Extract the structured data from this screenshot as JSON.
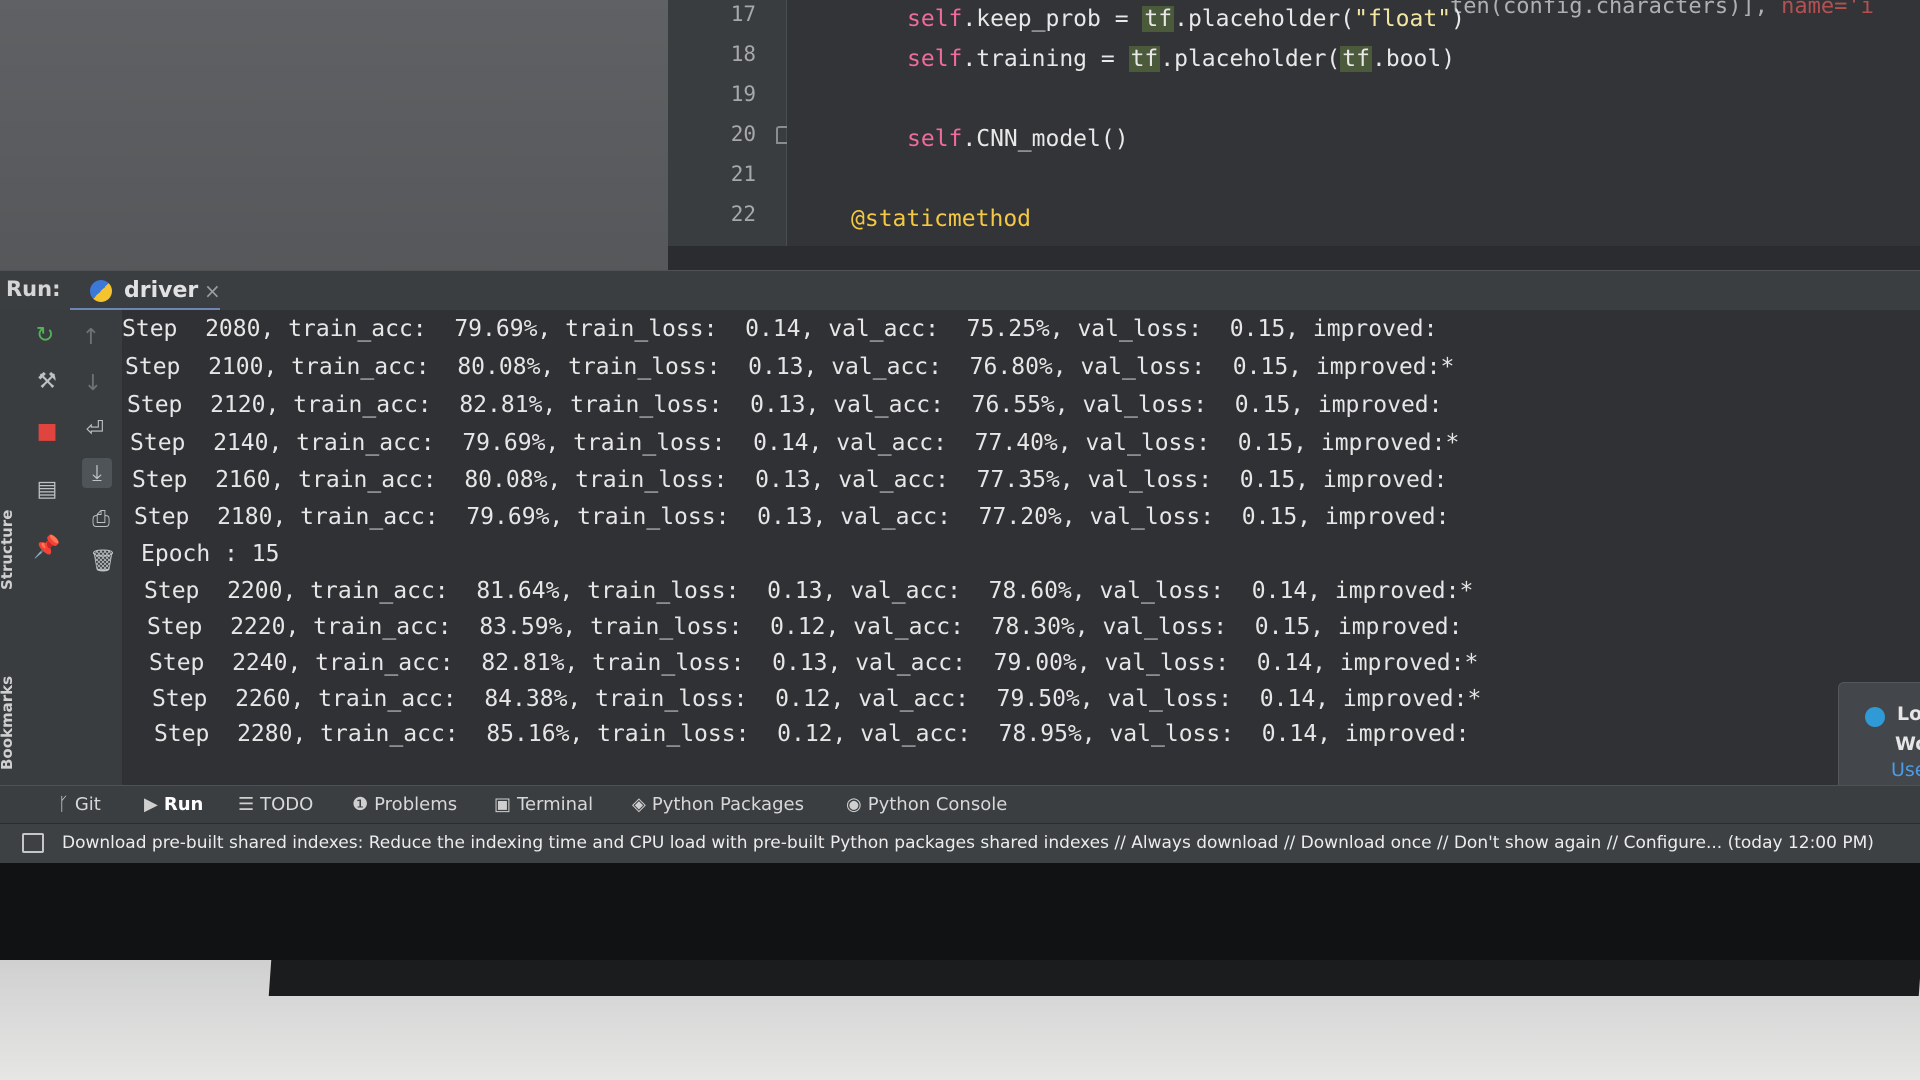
{
  "editor": {
    "line_numbers": [
      "17",
      "18",
      "19",
      "20",
      "21",
      "22"
    ],
    "lines": {
      "l17": {
        "self": "self",
        "mid": ".keep_prob = ",
        "tf": "tf",
        "rest": ".placeholder(",
        "str": "\"float\"",
        "end": ")"
      },
      "l18": {
        "self": "self",
        "mid": ".training = ",
        "tf": "tf",
        "rest": ".placeholder(",
        "tf2": "tf",
        "end": ".bool)"
      },
      "l20": {
        "self": "self",
        "rest": ".CNN_model()"
      },
      "l22": {
        "deco": "@staticmethod"
      }
    },
    "top_right_fragment": {
      "text": "ten(config.characters)], ",
      "red": "name='i"
    }
  },
  "run_window": {
    "label": "Run:",
    "tab_label": "driver",
    "close_glyph": "×",
    "console_lines": [
      "Step  2080, train_acc:  79.69%, train_loss:  0.14, val_acc:  75.25%, val_loss:  0.15, improved:",
      "Step  2100, train_acc:  80.08%, train_loss:  0.13, val_acc:  76.80%, val_loss:  0.15, improved:*",
      "Step  2120, train_acc:  82.81%, train_loss:  0.13, val_acc:  76.55%, val_loss:  0.15, improved:",
      "Step  2140, train_acc:  79.69%, train_loss:  0.14, val_acc:  77.40%, val_loss:  0.15, improved:*",
      "Step  2160, train_acc:  80.08%, train_loss:  0.13, val_acc:  77.35%, val_loss:  0.15, improved:",
      "Step  2180, train_acc:  79.69%, train_loss:  0.13, val_acc:  77.20%, val_loss:  0.15, improved:",
      "Epoch : 15",
      "Step  2200, train_acc:  81.64%, train_loss:  0.13, val_acc:  78.60%, val_loss:  0.14, improved:*",
      "Step  2220, train_acc:  83.59%, train_loss:  0.12, val_acc:  78.30%, val_loss:  0.15, improved:",
      "Step  2240, train_acc:  82.81%, train_loss:  0.13, val_acc:  79.00%, val_loss:  0.14, improved:*",
      "Step  2260, train_acc:  84.38%, train_loss:  0.12, val_acc:  79.50%, val_loss:  0.14, improved:*",
      "Step  2280, train_acc:  85.16%, train_loss:  0.12, val_acc:  78.95%, val_loss:  0.14, improved:"
    ]
  },
  "side_strip": {
    "structure": "Structure",
    "bookmarks": "Bookmarks"
  },
  "popup": {
    "line1": "Lo",
    "line2": "Wo",
    "link": "Use"
  },
  "bottom_tabs": [
    {
      "icon": "git-icon",
      "glyph": "ᚴ",
      "label": "Git"
    },
    {
      "icon": "run-icon",
      "glyph": "▶",
      "label": "Run"
    },
    {
      "icon": "todo-icon",
      "glyph": "☰",
      "label": "TODO"
    },
    {
      "icon": "problems-icon",
      "glyph": "❶",
      "label": "Problems"
    },
    {
      "icon": "terminal-icon",
      "glyph": "▣",
      "label": "Terminal"
    },
    {
      "icon": "python-packages-icon",
      "glyph": "◈",
      "label": "Python Packages"
    },
    {
      "icon": "python-console-icon",
      "glyph": "◉",
      "label": "Python Console"
    }
  ],
  "status_bar": {
    "message": "Download pre-built shared indexes: Reduce the indexing time and CPU load with pre-built Python packages shared indexes // Always download // Download once // Don't show again // Configure... (today 12:00 PM)"
  },
  "colors": {
    "accent_tab_underline": "#6d86b3",
    "self_keyword": "#f06a9a",
    "decorator": "#f5c842",
    "stop_button": "#e0443e",
    "rerun_button": "#53b359"
  }
}
